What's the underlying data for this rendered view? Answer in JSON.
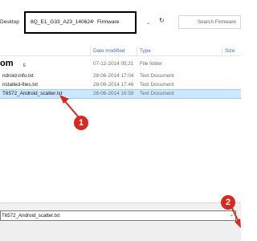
{
  "address": {
    "left_fragment": "Desktop",
    "crumbs": [
      "8Q_E1_G33_A23_140624",
      "Firmware"
    ],
    "separator": "›",
    "dropdown_glyph": "⌄",
    "refresh_glyph": "↻",
    "search_placeholder": "Search Firmware"
  },
  "columns": {
    "date": "Date modified",
    "type": "Type",
    "size": "Size"
  },
  "files": [
    {
      "name": "om",
      "sub": "E",
      "date": "07-12-2014 05:21",
      "type": "File folder"
    },
    {
      "name": "ndroid-info.txt",
      "date": "28-06-2014 17:04",
      "type": "Text Document"
    },
    {
      "name": "nstalled-files.txt",
      "date": "28-06-2014 17:46",
      "type": "Text Document"
    },
    {
      "name": "T6572_Android_scatter.txt",
      "date": "28-06-2014 16:59",
      "type": "Text Document",
      "selected": true
    }
  ],
  "annotations": {
    "badge1": "1",
    "badge2": "2",
    "color": "#d42a20"
  },
  "filename_field": {
    "value": "T6572_Android_scatter.txt",
    "chevron": "⌄"
  },
  "colors": {
    "selection": "#cce8ff",
    "header_text": "#4a6bbd"
  }
}
